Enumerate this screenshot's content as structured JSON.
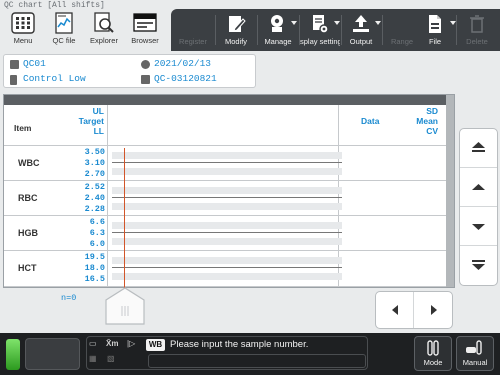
{
  "window": {
    "title": "QC chart [All shifts]"
  },
  "left_tools": [
    {
      "label": "Menu",
      "icon": "grid-menu-icon"
    },
    {
      "label": "QC file",
      "icon": "qc-file-icon"
    },
    {
      "label": "Explorer",
      "icon": "explorer-search-icon"
    },
    {
      "label": "Browser",
      "icon": "browser-window-icon"
    }
  ],
  "toolbar": {
    "register": "Register",
    "modify": "Modify",
    "manage": "Manage",
    "display_settings": "splay setting",
    "output": "Output",
    "range": "Range",
    "file": "File",
    "delete": "Delete"
  },
  "info": {
    "qc_name": "QC01",
    "date": "2021/02/13",
    "control": "Control Low",
    "qc_id": "QC-03120821"
  },
  "table": {
    "item_header": "Item",
    "ul_header": "UL",
    "target_header": "Target",
    "ll_header": "LL",
    "data_header": "Data",
    "sd_header": "SD",
    "mean_header": "Mean",
    "cv_header": "CV",
    "rows": [
      {
        "item": "WBC",
        "ul": "3.50",
        "target": "3.10",
        "ll": "2.70"
      },
      {
        "item": "RBC",
        "ul": "2.52",
        "target": "2.40",
        "ll": "2.28"
      },
      {
        "item": "HGB",
        "ul": "6.6",
        "target": "6.3",
        "ll": "6.0"
      },
      {
        "item": "HCT",
        "ul": "19.5",
        "target": "18.0",
        "ll": "16.5"
      }
    ],
    "n_label": "n=0"
  },
  "status": {
    "sample_type": "WB",
    "message": "Please input the sample number.",
    "xm_label": "X̄m",
    "mode_label": "Mode",
    "manual_label": "Manual"
  },
  "colors": {
    "accent_blue": "#1a8ad0",
    "toolbar_dark": "#3b3f43",
    "cursor_orange": "#d2562a",
    "status_green": "#4cc33a"
  }
}
